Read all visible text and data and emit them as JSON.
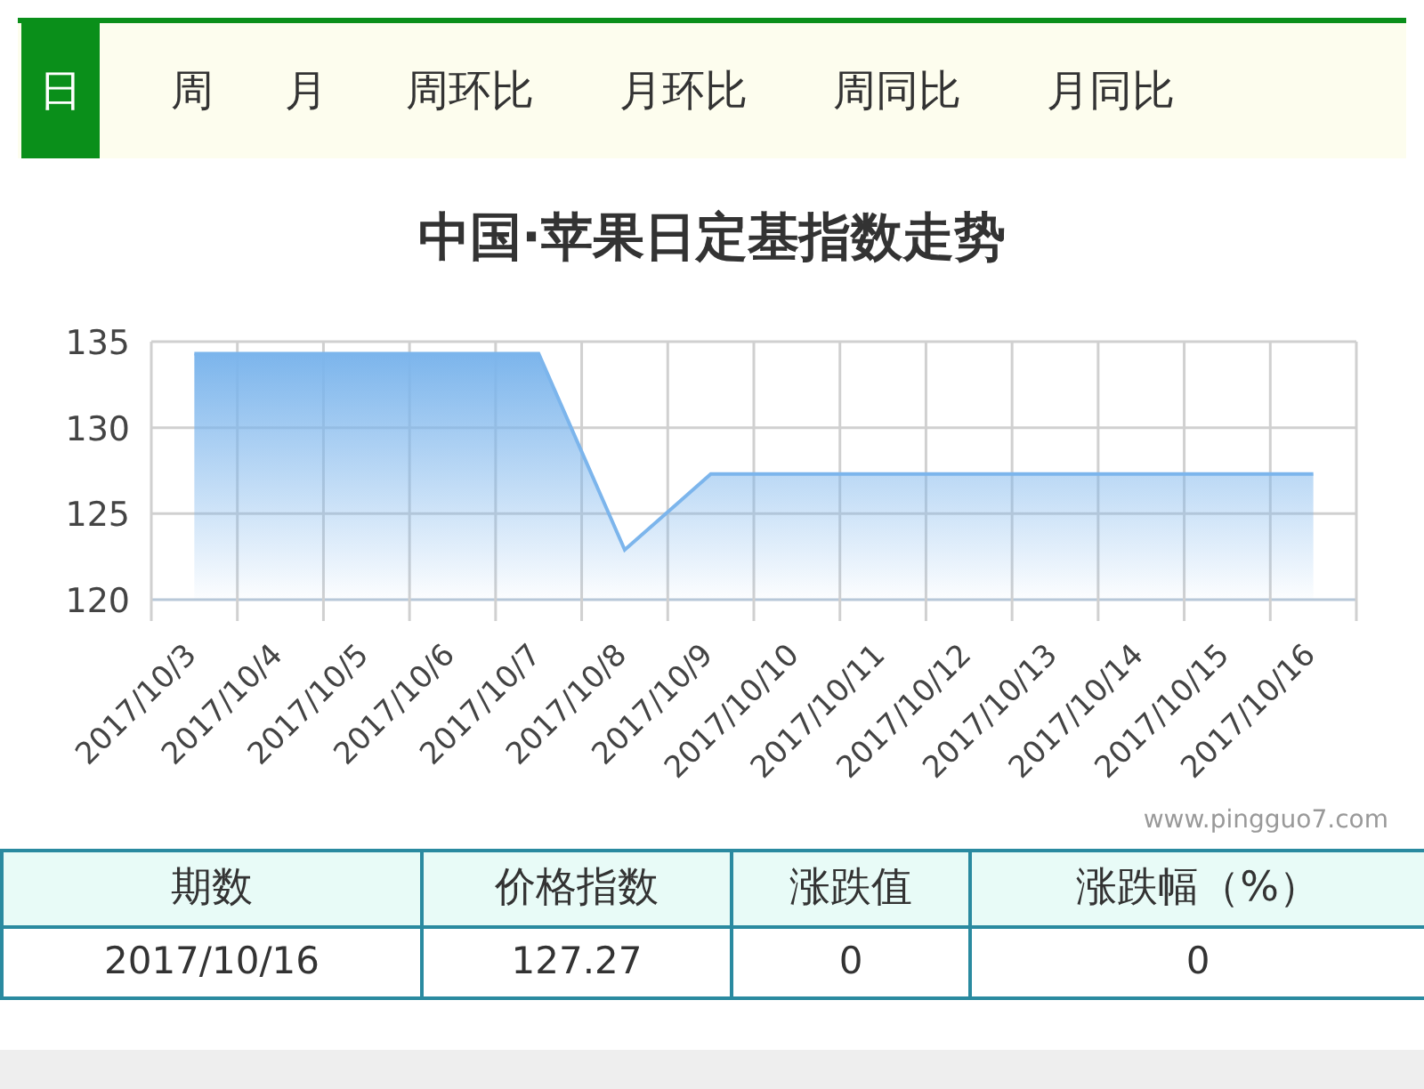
{
  "tabs": [
    {
      "label": "日",
      "selected": true
    },
    {
      "label": "周",
      "selected": false
    },
    {
      "label": "月",
      "selected": false
    },
    {
      "label": "周环比",
      "selected": false
    },
    {
      "label": "月环比",
      "selected": false
    },
    {
      "label": "周同比",
      "selected": false
    },
    {
      "label": "月同比",
      "selected": false
    }
  ],
  "chart": {
    "credit": "www.pingguo7.com",
    "chart_data": {
      "type": "area",
      "title": "中国·苹果日定基指数走势",
      "categories": [
        "2017/10/3",
        "2017/10/4",
        "2017/10/5",
        "2017/10/6",
        "2017/10/7",
        "2017/10/8",
        "2017/10/9",
        "2017/10/10",
        "2017/10/11",
        "2017/10/12",
        "2017/10/13",
        "2017/10/14",
        "2017/10/15",
        "2017/10/16"
      ],
      "series": [
        {
          "color": "#7cb5ec",
          "values": [
            134.3,
            134.3,
            134.3,
            134.3,
            134.3,
            122.9,
            127.3,
            127.3,
            127.3,
            127.3,
            127.3,
            127.3,
            127.3,
            127.3
          ]
        }
      ],
      "grid": true,
      "ylim": [
        120,
        135
      ],
      "yticks": [
        120,
        125,
        130,
        135
      ]
    }
  },
  "table": {
    "columns": [
      "期数",
      "价格指数",
      "涨跌值",
      "涨跌幅（%）"
    ],
    "rows": [
      [
        "2017/10/16",
        "127.27",
        "0",
        "0"
      ]
    ]
  }
}
